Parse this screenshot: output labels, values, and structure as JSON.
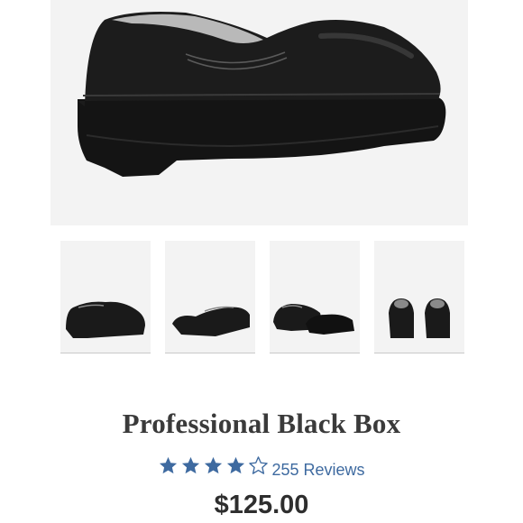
{
  "product": {
    "title": "Professional Black Box",
    "rating": {
      "value": 4,
      "max": 5,
      "reviews_label": "255 Reviews",
      "star_color": "#3e6aa0"
    },
    "price": "$125.00"
  },
  "gallery": {
    "main_image": "black-clog-side-view",
    "thumbnails": [
      {
        "name": "thumb-side-view"
      },
      {
        "name": "thumb-angled-view"
      },
      {
        "name": "thumb-pair-view"
      },
      {
        "name": "thumb-back-view"
      }
    ]
  }
}
